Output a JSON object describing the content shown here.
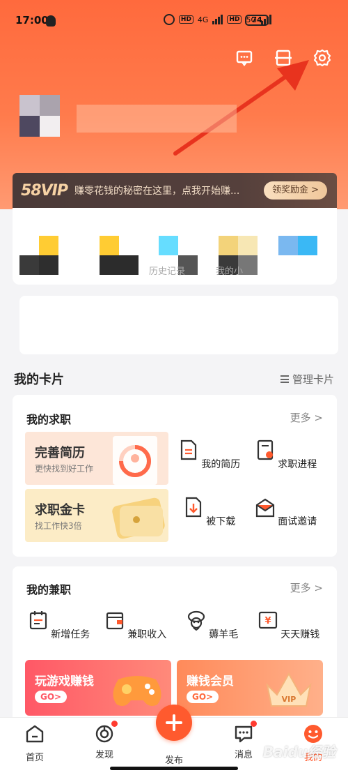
{
  "status": {
    "time": "17:00",
    "net1": "4G",
    "net2": "5G",
    "battery": "74"
  },
  "vip": {
    "logo": "58VIP",
    "text": "赚零花钱的秘密在这里，点我开始赚...",
    "button": "领奖励金 >"
  },
  "quick": {
    "label1": "历史记录",
    "label2": "我的小"
  },
  "cards_section": {
    "title": "我的卡片",
    "manage": "管理卡片"
  },
  "job": {
    "title": "我的求职",
    "more": "更多 >",
    "promo1": {
      "title": "完善简历",
      "sub": "更快找到好工作"
    },
    "promo2": {
      "title": "求职金卡",
      "sub": "找工作快3倍"
    },
    "items": [
      "我的简历",
      "求职进程",
      "被下载",
      "面试邀请"
    ]
  },
  "parttime": {
    "title": "我的兼职",
    "more": "更多 >",
    "items": [
      "新增任务",
      "兼职收入",
      "薅羊毛",
      "天天赚钱"
    ],
    "promo1": {
      "title": "玩游戏赚钱",
      "go": "GO>"
    },
    "promo2": {
      "title": "赚钱会员",
      "go": "GO>"
    }
  },
  "tabs": [
    "首页",
    "发现",
    "发布",
    "消息",
    "我的"
  ],
  "watermark": "Baidu经验",
  "colors": {
    "accent": "#ff5a2e",
    "header": "#ff6a3d",
    "vip_bg": "#4a3a38"
  }
}
